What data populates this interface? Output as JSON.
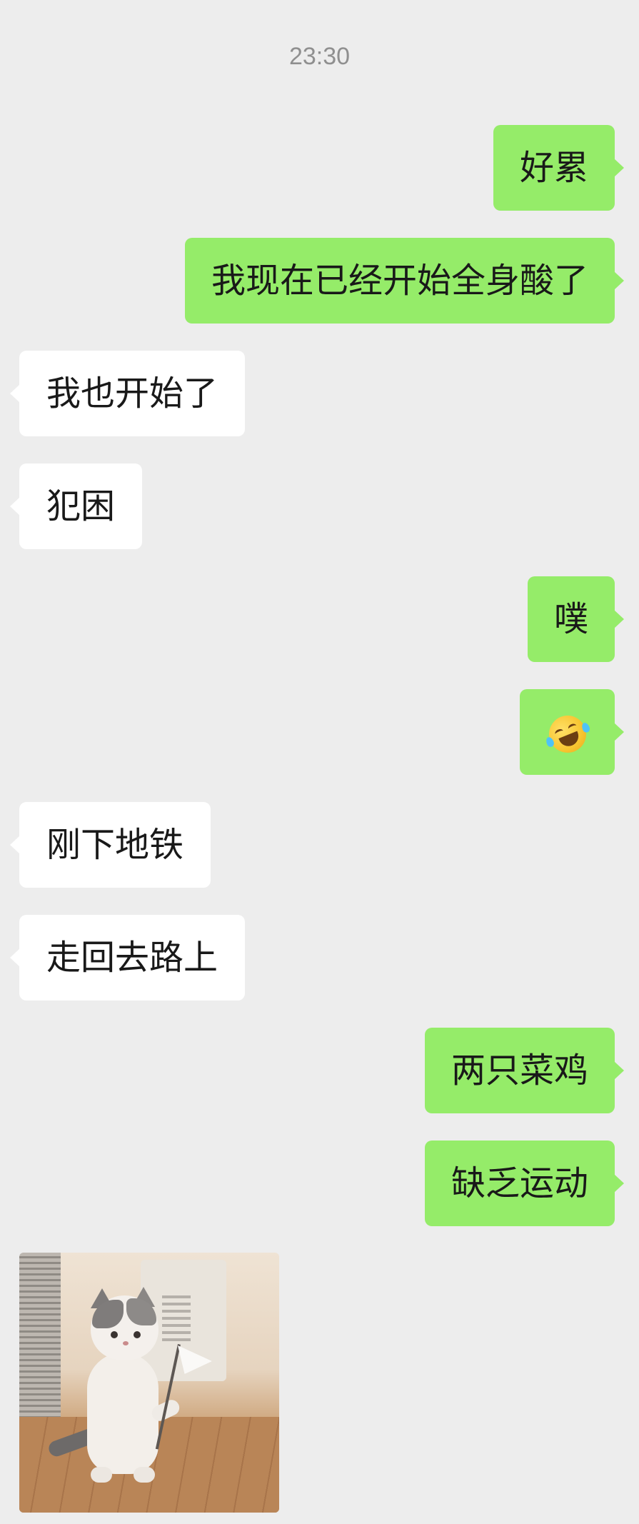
{
  "chat": {
    "timestamp": "23:30",
    "messages": [
      {
        "text": "好累",
        "direction": "out"
      },
      {
        "text": "我现在已经开始全身酸了",
        "direction": "out"
      },
      {
        "text": "我也开始了",
        "direction": "in"
      },
      {
        "text": "犯困",
        "direction": "in"
      },
      {
        "text": "噗",
        "direction": "out"
      },
      {
        "text": "",
        "direction": "out",
        "emoji": "rolling-on-the-floor-laughing-emoji"
      },
      {
        "text": "刚下地铁",
        "direction": "in"
      },
      {
        "text": "走回去路上",
        "direction": "in"
      },
      {
        "text": "两只菜鸡",
        "direction": "out"
      },
      {
        "text": "缺乏运动",
        "direction": "out"
      },
      {
        "text": "",
        "direction": "in",
        "sticker": "cat-holding-white-flag-sticker"
      }
    ]
  },
  "colors": {
    "background": "#ededed",
    "outgoing_bubble": "#95ec69",
    "incoming_bubble": "#ffffff",
    "timestamp": "#8f8f8f",
    "text": "#191919"
  }
}
